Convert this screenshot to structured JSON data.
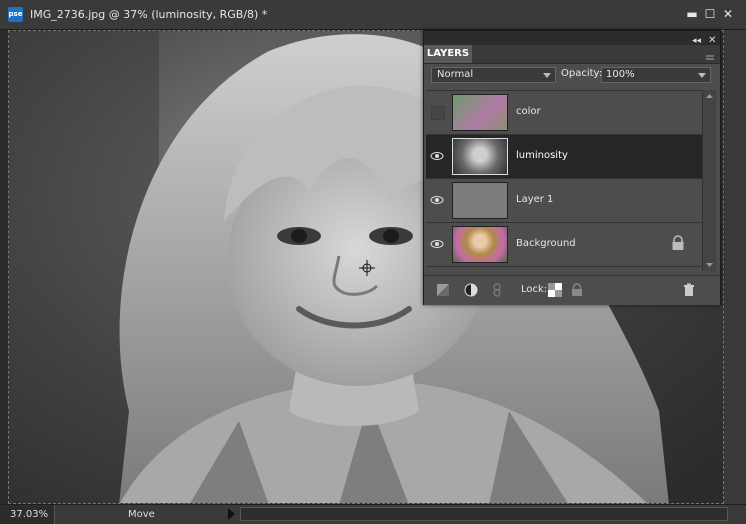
{
  "window": {
    "app_badge": "pse",
    "title": "IMG_2736.jpg @ 37% (luminosity, RGB/8) *",
    "minimize": "▬",
    "maximize": "☐",
    "close": "✕"
  },
  "status": {
    "zoom": "37.03%",
    "tool": "Move"
  },
  "layers_panel": {
    "tab": "LAYERS",
    "blend_mode": "Normal",
    "opacity_label": "Opacity:",
    "opacity_value": "100%",
    "lock_label": "Lock:",
    "layers": [
      {
        "name": "color",
        "visible": false,
        "active": false
      },
      {
        "name": "luminosity",
        "visible": true,
        "active": true
      },
      {
        "name": "Layer 1",
        "visible": true,
        "active": false
      },
      {
        "name": "Background",
        "visible": true,
        "active": false,
        "locked": true
      }
    ]
  },
  "colors": {
    "app_badge": "#1f73c4",
    "active_layer": "#262626",
    "panel": "#4d4d4d"
  },
  "icons": [
    "app-badge-icon",
    "eye-icon",
    "lock-icon",
    "new-layer-icon",
    "adjustment-layer-icon",
    "link-icon",
    "transparency-lock-icon",
    "trash-icon"
  ]
}
